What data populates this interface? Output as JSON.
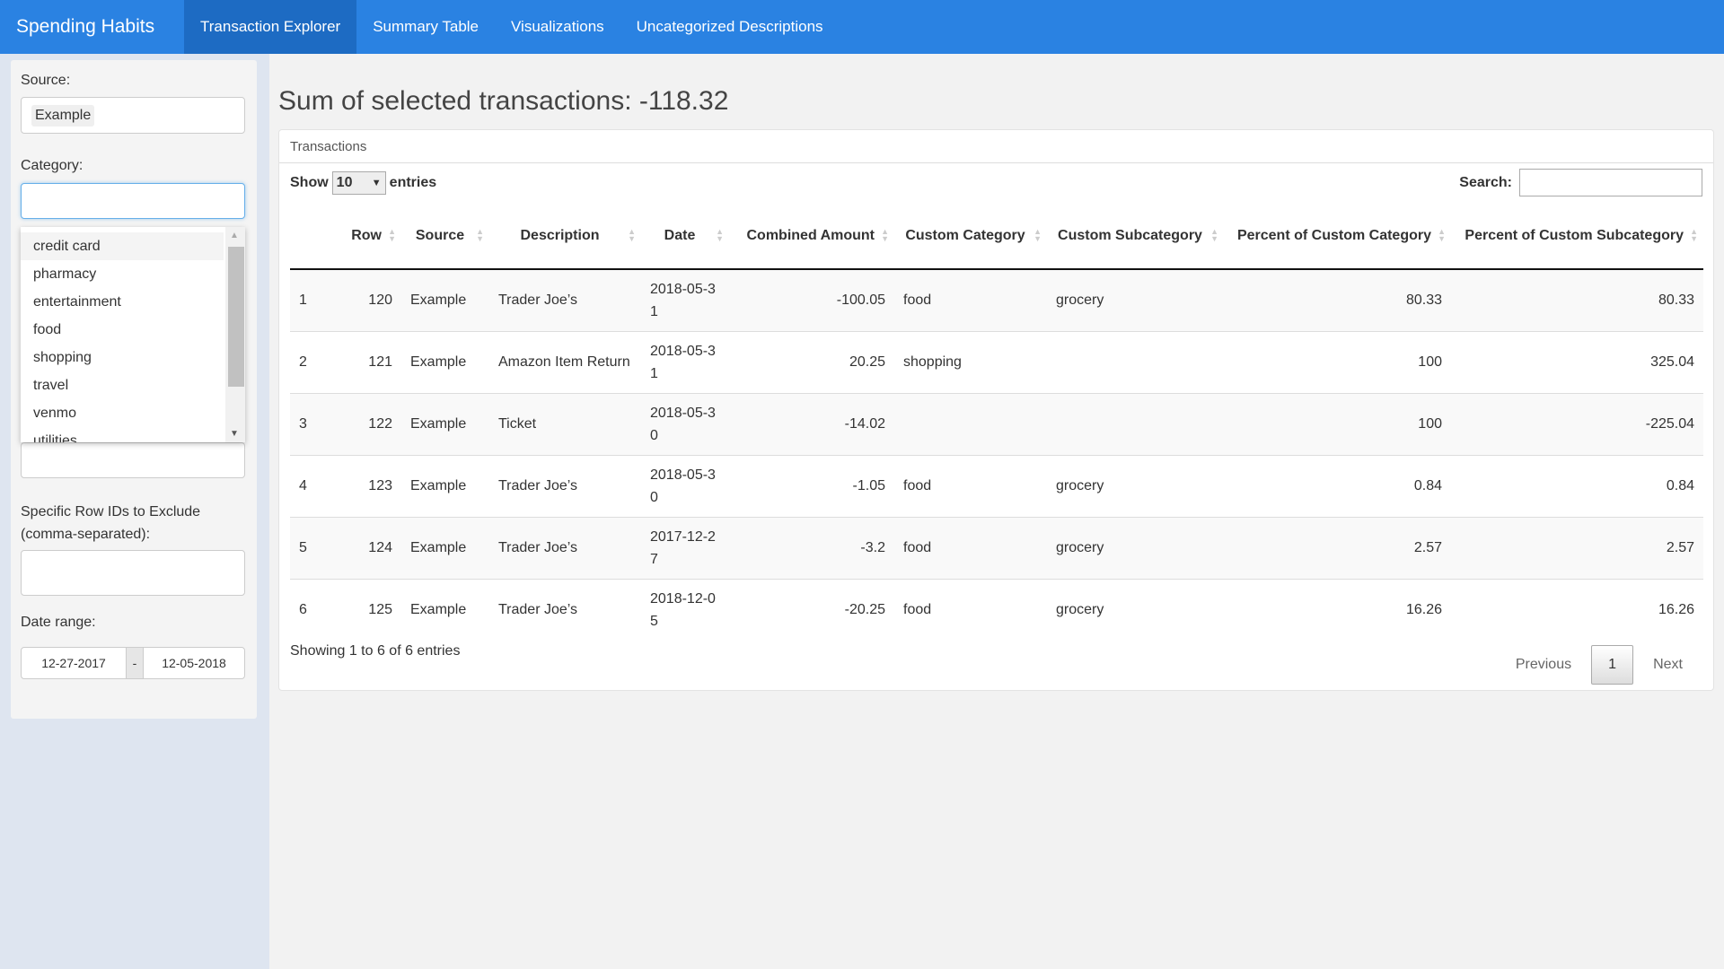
{
  "nav": {
    "brand": "Spending Habits",
    "tabs": [
      {
        "label": "Transaction Explorer",
        "active": true
      },
      {
        "label": "Summary Table"
      },
      {
        "label": "Visualizations"
      },
      {
        "label": "Uncategorized Descriptions"
      }
    ]
  },
  "sidebar": {
    "source_label": "Source:",
    "source_value": "Example",
    "category_label": "Category:",
    "category_options": [
      "credit card",
      "pharmacy",
      "entertainment",
      "food",
      "shopping",
      "travel",
      "venmo",
      "utilities"
    ],
    "exclude_label": "Specific Row IDs to Exclude (comma-separated):",
    "date_label": "Date range:",
    "date_start": "12-27-2017",
    "date_sep": "-",
    "date_end": "12-05-2018"
  },
  "main": {
    "title": "Sum of selected transactions: -118.32",
    "panel_title": "Transactions",
    "show": "Show",
    "entries_value": "10",
    "entries": "entries",
    "search_label": "Search:",
    "columns": [
      "",
      "Row",
      "Source",
      "Description",
      "Date",
      "Combined Amount",
      "Custom Category",
      "Custom Subcategory",
      "Percent of Custom Category",
      "Percent of Custom Subcategory"
    ],
    "rows": [
      [
        "1",
        "120",
        "Example",
        "Trader Joe’s",
        "2018-05-31",
        "-100.05",
        "food",
        "grocery",
        "80.33",
        "80.33"
      ],
      [
        "2",
        "121",
        "Example",
        "Amazon Item Return",
        "2018-05-31",
        "20.25",
        "shopping",
        "",
        "100",
        "325.04"
      ],
      [
        "3",
        "122",
        "Example",
        "Ticket",
        "2018-05-30",
        "-14.02",
        "",
        "",
        "100",
        "-225.04"
      ],
      [
        "4",
        "123",
        "Example",
        "Trader Joe’s",
        "2018-05-30",
        "-1.05",
        "food",
        "grocery",
        "0.84",
        "0.84"
      ],
      [
        "5",
        "124",
        "Example",
        "Trader Joe’s",
        "2017-12-27",
        "-3.2",
        "food",
        "grocery",
        "2.57",
        "2.57"
      ],
      [
        "6",
        "125",
        "Example",
        "Trader Joe’s",
        "2018-12-05",
        "-20.25",
        "food",
        "grocery",
        "16.26",
        "16.26"
      ]
    ],
    "info": "Showing 1 to 6 of 6 entries",
    "prev": "Previous",
    "page": "1",
    "next": "Next"
  }
}
